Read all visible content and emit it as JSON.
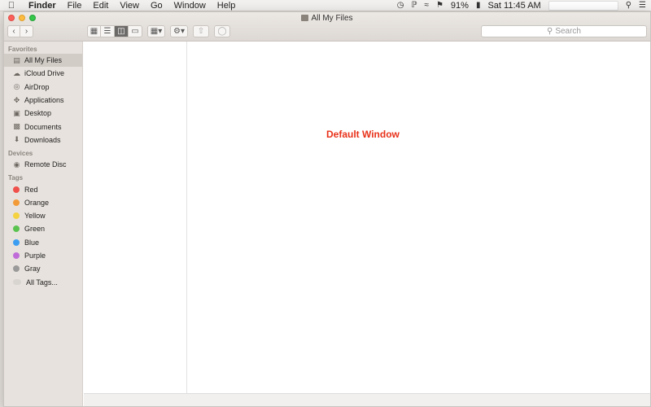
{
  "menubar": {
    "app_name": "Finder",
    "menus": [
      "File",
      "Edit",
      "View",
      "Go",
      "Window",
      "Help"
    ],
    "battery": "91%",
    "clock": "Sat 11:45 AM"
  },
  "window": {
    "title": "All My Files",
    "search_placeholder": "Search"
  },
  "sidebar": {
    "favorites_label": "Favorites",
    "favorites": [
      {
        "label": "All My Files",
        "icon": "all-files-icon"
      },
      {
        "label": "iCloud Drive",
        "icon": "cloud-icon"
      },
      {
        "label": "AirDrop",
        "icon": "airdrop-icon"
      },
      {
        "label": "Applications",
        "icon": "applications-icon"
      },
      {
        "label": "Desktop",
        "icon": "desktop-icon"
      },
      {
        "label": "Documents",
        "icon": "documents-icon"
      },
      {
        "label": "Downloads",
        "icon": "downloads-icon"
      }
    ],
    "devices_label": "Devices",
    "devices": [
      {
        "label": "Remote Disc",
        "icon": "disc-icon"
      }
    ],
    "tags_label": "Tags",
    "tags": [
      {
        "label": "Red",
        "color": "#f0504b"
      },
      {
        "label": "Orange",
        "color": "#f39a38"
      },
      {
        "label": "Yellow",
        "color": "#f5d23f"
      },
      {
        "label": "Green",
        "color": "#5ac34f"
      },
      {
        "label": "Blue",
        "color": "#3d9ef1"
      },
      {
        "label": "Purple",
        "color": "#c06cd8"
      },
      {
        "label": "Gray",
        "color": "#9a9a9a"
      },
      {
        "label": "All Tags...",
        "color": "#d8d4d0"
      }
    ]
  },
  "annotation": "Default Window"
}
